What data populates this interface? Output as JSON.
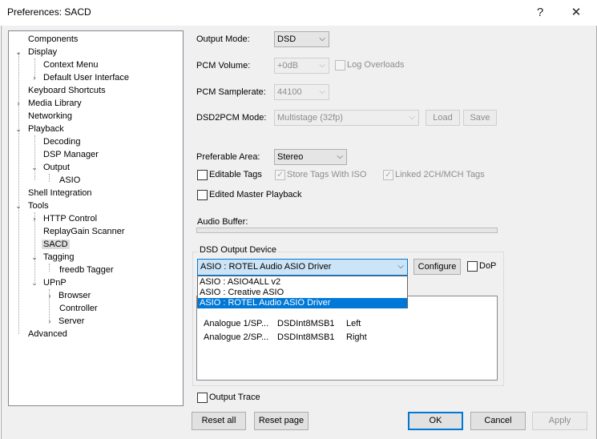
{
  "window": {
    "title": "Preferences: SACD",
    "help_glyph": "?",
    "close_glyph": "✕"
  },
  "tree": [
    {
      "label": "Components"
    },
    {
      "label": "Display",
      "toggle": "⌄"
    },
    {
      "label": "Context Menu"
    },
    {
      "label": "Default User Interface",
      "toggle": "›"
    },
    {
      "label": "Keyboard Shortcuts"
    },
    {
      "label": "Media Library",
      "toggle": "›"
    },
    {
      "label": "Networking"
    },
    {
      "label": "Playback",
      "toggle": "⌄"
    },
    {
      "label": "Decoding"
    },
    {
      "label": "DSP Manager"
    },
    {
      "label": "Output",
      "toggle": "⌄"
    },
    {
      "label": "ASIO"
    },
    {
      "label": "Shell Integration"
    },
    {
      "label": "Tools",
      "toggle": "⌄"
    },
    {
      "label": "HTTP Control",
      "toggle": "›"
    },
    {
      "label": "ReplayGain Scanner"
    },
    {
      "label": "SACD",
      "selected": true
    },
    {
      "label": "Tagging",
      "toggle": "⌄"
    },
    {
      "label": "freedb Tagger"
    },
    {
      "label": "UPnP",
      "toggle": "⌄"
    },
    {
      "label": "Browser",
      "toggle": "›"
    },
    {
      "label": "Controller"
    },
    {
      "label": "Server",
      "toggle": "›"
    },
    {
      "label": "Advanced"
    }
  ],
  "settings": {
    "output_mode": {
      "label": "Output Mode:",
      "value": "DSD"
    },
    "pcm_volume": {
      "label": "PCM Volume:",
      "value": "+0dB"
    },
    "log_overloads": {
      "label": "Log Overloads"
    },
    "pcm_samplerate": {
      "label": "PCM Samplerate:",
      "value": "44100"
    },
    "dsd2pcm_mode": {
      "label": "DSD2PCM Mode:",
      "value": "Multistage (32fp)"
    },
    "load_button": "Load",
    "save_button": "Save",
    "preferable_area": {
      "label": "Preferable Area:",
      "value": "Stereo"
    },
    "editable_tags": {
      "label": "Editable Tags",
      "checked": false
    },
    "store_tags_iso": {
      "label": "Store Tags With ISO",
      "checked": true
    },
    "linked_tags": {
      "label": "Linked 2CH/MCH Tags",
      "checked": true
    },
    "edited_master": {
      "label": "Edited Master Playback",
      "checked": false
    },
    "audio_buffer": {
      "label": "Audio Buffer:",
      "fill_fraction": 0
    },
    "output_trace": {
      "label": "Output Trace",
      "checked": false
    }
  },
  "dsd_output": {
    "group_title": "DSD Output Device",
    "device_value": "ASIO : ROTEL Audio ASIO Driver",
    "configure_button": "Configure",
    "dop_label": "DoP",
    "dropdown_options": [
      {
        "label": "ASIO : ASIO4ALL v2"
      },
      {
        "label": "ASIO : Creative ASIO"
      },
      {
        "label": "ASIO : ROTEL Audio ASIO Driver",
        "selected": true
      }
    ],
    "channel_rows": [
      {
        "channel": "Analogue 1/SP...",
        "format": "DSDInt8MSB1",
        "mapping": "Left"
      },
      {
        "channel": "Analogue 2/SP...",
        "format": "DSDInt8MSB1",
        "mapping": "Right"
      }
    ]
  },
  "footer": {
    "reset_all": "Reset all",
    "reset_page": "Reset page",
    "ok": "OK",
    "cancel": "Cancel",
    "apply": "Apply"
  },
  "glyphs": {
    "chevron_down": "⌵",
    "check": "✓"
  }
}
